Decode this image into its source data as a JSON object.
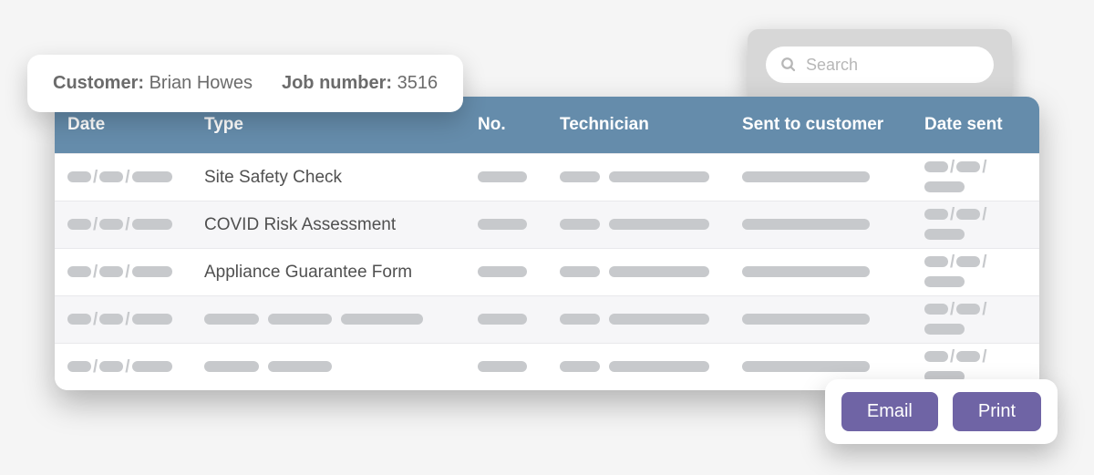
{
  "search": {
    "placeholder": "Search"
  },
  "info": {
    "customer_label": "Customer:",
    "customer_value": "Brian Howes",
    "job_label": "Job number:",
    "job_value": "3516"
  },
  "columns": {
    "date": "Date",
    "type": "Type",
    "no": "No.",
    "technician": "Technician",
    "sent": "Sent to customer",
    "date_sent": "Date sent"
  },
  "rows": [
    {
      "type": "Site Safety Check"
    },
    {
      "type": "COVID Risk Assessment"
    },
    {
      "type": "Appliance Guarantee Form"
    },
    {
      "type": null
    },
    {
      "type": null
    }
  ],
  "actions": {
    "email": "Email",
    "print": "Print"
  },
  "colors": {
    "header": "#658cab",
    "button": "#6f64a5",
    "skeleton": "#c7c9cc"
  }
}
